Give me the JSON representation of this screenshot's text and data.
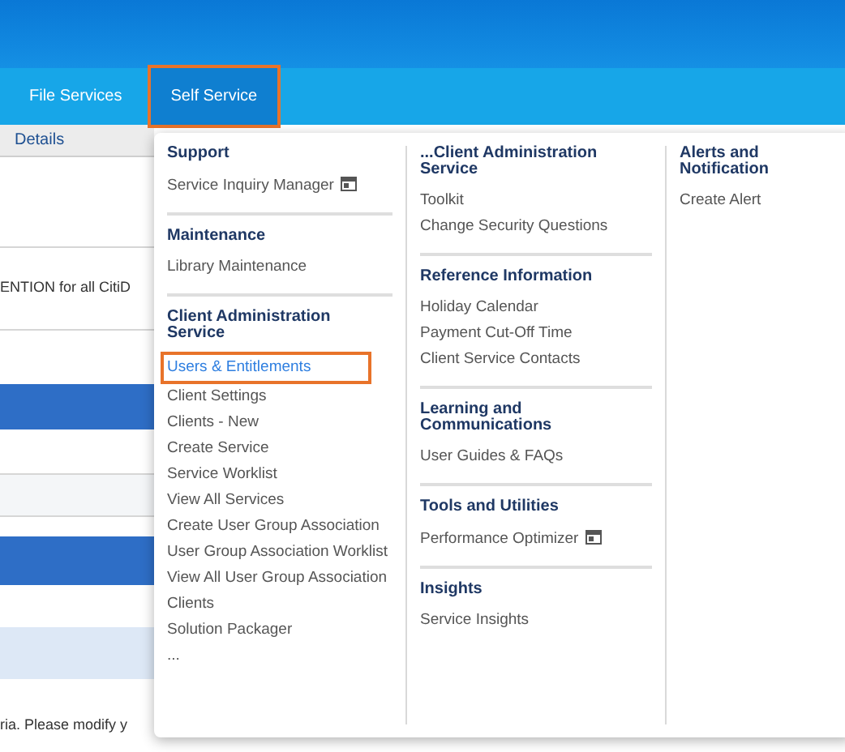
{
  "nav": {
    "tabs": [
      {
        "label": "File Services",
        "selected": false,
        "callout": false
      },
      {
        "label": "Self Service",
        "selected": true,
        "callout": true
      }
    ]
  },
  "page": {
    "tab_label": "Details",
    "notice": "ENTION for all CitiD",
    "message": "ria. Please modify y"
  },
  "menu": {
    "columns": [
      {
        "sections": [
          {
            "heading": "Support",
            "links": [
              {
                "label": "Service Inquiry Manager",
                "external": true,
                "callout": false
              }
            ]
          },
          {
            "heading": "Maintenance",
            "links": [
              {
                "label": "Library Maintenance",
                "external": false,
                "callout": false
              }
            ]
          },
          {
            "heading": "Client Administration Service",
            "links": [
              {
                "label": "Users & Entitlements",
                "external": false,
                "callout": true
              },
              {
                "label": "Client Settings",
                "external": false,
                "callout": false
              },
              {
                "label": "Clients - New",
                "external": false,
                "callout": false
              },
              {
                "label": "Create Service",
                "external": false,
                "callout": false
              },
              {
                "label": "Service Worklist",
                "external": false,
                "callout": false
              },
              {
                "label": "View All Services",
                "external": false,
                "callout": false
              },
              {
                "label": "Create User Group Association",
                "external": false,
                "callout": false
              },
              {
                "label": "User Group Association Worklist",
                "external": false,
                "callout": false
              },
              {
                "label": "View All User Group Association",
                "external": false,
                "callout": false
              },
              {
                "label": "Clients",
                "external": false,
                "callout": false
              },
              {
                "label": "Solution Packager",
                "external": false,
                "callout": false
              },
              {
                "label": "...",
                "external": false,
                "callout": false
              }
            ]
          }
        ]
      },
      {
        "sections": [
          {
            "heading": "...Client Administration Service",
            "links": [
              {
                "label": "Toolkit",
                "external": false,
                "callout": false
              },
              {
                "label": "Change Security Questions",
                "external": false,
                "callout": false
              }
            ]
          },
          {
            "heading": "Reference Information",
            "links": [
              {
                "label": "Holiday Calendar",
                "external": false,
                "callout": false
              },
              {
                "label": "Payment Cut-Off Time",
                "external": false,
                "callout": false
              },
              {
                "label": "Client Service Contacts",
                "external": false,
                "callout": false
              }
            ]
          },
          {
            "heading": "Learning and Communications",
            "links": [
              {
                "label": "User Guides & FAQs",
                "external": false,
                "callout": false
              }
            ]
          },
          {
            "heading": "Tools and Utilities",
            "links": [
              {
                "label": "Performance Optimizer",
                "external": true,
                "callout": false
              }
            ]
          },
          {
            "heading": "Insights",
            "links": [
              {
                "label": "Service Insights",
                "external": false,
                "callout": false
              }
            ]
          }
        ]
      },
      {
        "sections": [
          {
            "heading": "Alerts and Notification",
            "links": [
              {
                "label": "Create Alert",
                "external": false,
                "callout": false
              }
            ]
          }
        ]
      }
    ]
  }
}
